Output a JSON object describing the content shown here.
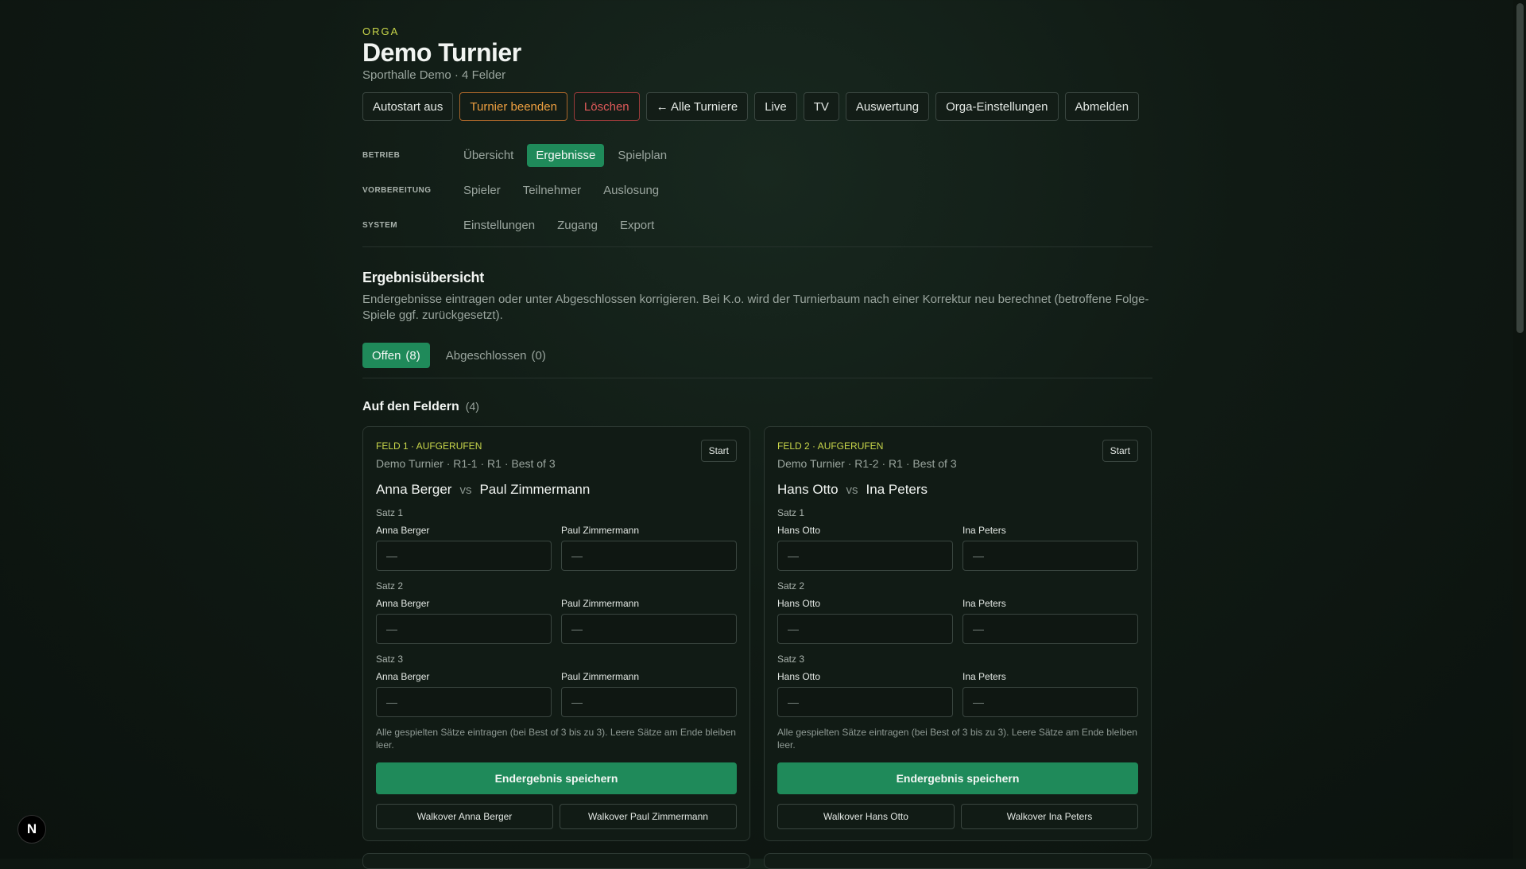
{
  "header": {
    "eyebrow": "ORGA",
    "title": "Demo Turnier",
    "subtitle": "Sporthalle Demo · 4 Felder"
  },
  "actions": [
    {
      "label": "Autostart aus",
      "style": "normal"
    },
    {
      "label": "Turnier beenden",
      "style": "orange"
    },
    {
      "label": "Löschen",
      "style": "red"
    },
    {
      "label": "← Alle Turniere",
      "style": "normal"
    },
    {
      "label": "Live",
      "style": "normal"
    },
    {
      "label": "TV",
      "style": "normal"
    },
    {
      "label": "Auswertung",
      "style": "normal"
    },
    {
      "label": "Orga-Einstellungen",
      "style": "normal"
    },
    {
      "label": "Abmelden",
      "style": "normal"
    }
  ],
  "nav": {
    "betrieb": {
      "label": "BETRIEB",
      "items": [
        "Übersicht",
        "Ergebnisse",
        "Spielplan"
      ],
      "active": "Ergebnisse"
    },
    "vorbereitung": {
      "label": "VORBEREITUNG",
      "items": [
        "Spieler",
        "Teilnehmer",
        "Auslosung"
      ]
    },
    "system": {
      "label": "SYSTEM",
      "items": [
        "Einstellungen",
        "Zugang",
        "Export"
      ]
    }
  },
  "section": {
    "title": "Ergebnisübersicht",
    "description": "Endergebnisse eintragen oder unter Abgeschlossen korrigieren. Bei K.o. wird der Turnierbaum nach einer Korrektur neu berechnet (betroffene Folge-Spiele ggf. zurückgesetzt)."
  },
  "tabs": {
    "open": {
      "label": "Offen",
      "count": "(8)"
    },
    "closed": {
      "label": "Abgeschlossen",
      "count": "(0)"
    }
  },
  "subsection": {
    "title": "Auf den Feldern",
    "count": "(4)"
  },
  "matches": [
    {
      "status": "FELD 1 · AUFGERUFEN",
      "start_label": "Start",
      "meta": "Demo Turnier · R1-1 · R1 · Best of 3",
      "player_a": "Anna Berger",
      "vs": "vs",
      "player_b": "Paul Zimmermann",
      "sets": [
        "Satz 1",
        "Satz 2",
        "Satz 3"
      ],
      "placeholder": "—",
      "hint": "Alle gespielten Sätze eintragen (bei Best of 3 bis zu 3). Leere Sätze am Ende bleiben leer.",
      "save_label": "Endergebnis speichern",
      "walkover_a": "Walkover Anna Berger",
      "walkover_b": "Walkover Paul Zimmermann"
    },
    {
      "status": "FELD 2 · AUFGERUFEN",
      "start_label": "Start",
      "meta": "Demo Turnier · R1-2 · R1 · Best of 3",
      "player_a": "Hans Otto",
      "vs": "vs",
      "player_b": "Ina Peters",
      "sets": [
        "Satz 1",
        "Satz 2",
        "Satz 3"
      ],
      "placeholder": "—",
      "hint": "Alle gespielten Sätze eintragen (bei Best of 3 bis zu 3). Leere Sätze am Ende bleiben leer.",
      "save_label": "Endergebnis speichern",
      "walkover_a": "Walkover Hans Otto",
      "walkover_b": "Walkover Ina Peters"
    }
  ],
  "badge": {
    "letter": "N"
  },
  "colors": {
    "accent": "#1f8a5a",
    "eyebrow": "#c9d64a",
    "danger": "#e05a5a",
    "warning": "#f0a040"
  }
}
